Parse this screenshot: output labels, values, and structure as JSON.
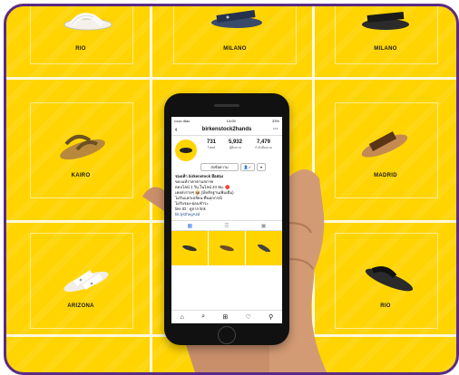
{
  "tiles": [
    {
      "label": "RIO"
    },
    {
      "label": "MILANO"
    },
    {
      "label": "MILANO"
    },
    {
      "label": "KAIRO"
    },
    {
      "label": "MADRID"
    },
    {
      "label": "ARIZONA"
    },
    {
      "label": "RIO"
    }
  ],
  "phone": {
    "status": {
      "carrier": "•••oo dtac",
      "time": "14:09",
      "battery": "33%"
    },
    "username": "birkenstock2hands",
    "stats": [
      {
        "value": "731",
        "label": "โพสต์"
      },
      {
        "value": "5,932",
        "label": "ผู้ติดตาม"
      },
      {
        "value": "7,479",
        "label": "กำลังติดตาม"
      }
    ],
    "edit_button": "ส่งข้อความ",
    "bio": {
      "name": "รองเท้า birkenstock มือสอง",
      "lines": [
        "ของแท้ราคาตามสภาพ",
        "ตอบไลน์ 1 วัน ในไลน์ 24 ชม. 🔴",
        "เคยส่งรายๆ 📦 (มีหลักฐานเพิ่มเติม)",
        "ไม่รับแลกเปลี่ยน-คืนทุกกรณี",
        "ไม่รับจอง-ผ่อนชำระ",
        "line ID : ดูจาก link",
        "bit.ly/2hegA2d"
      ]
    }
  },
  "colors": {
    "background": "#ffd400",
    "border": "#5b2a86"
  }
}
